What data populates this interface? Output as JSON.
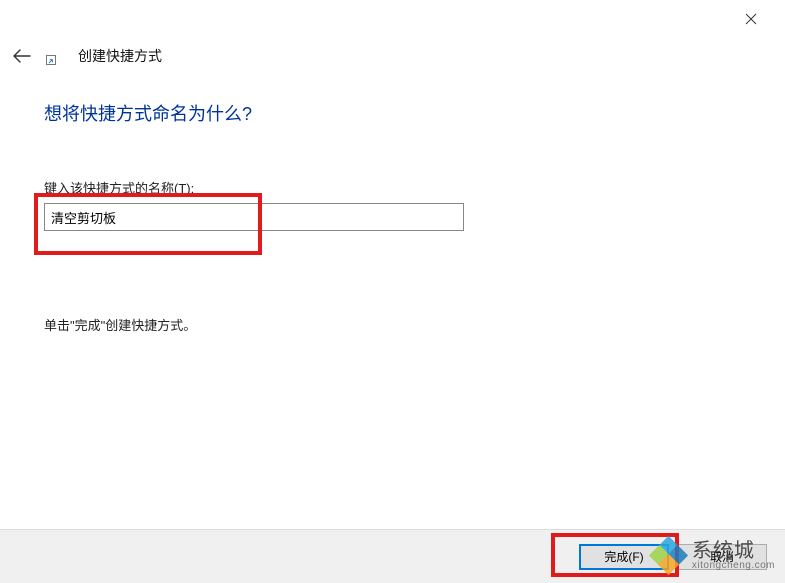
{
  "window": {
    "wizard_title": "创建快捷方式"
  },
  "content": {
    "heading": "想将快捷方式命名为什么?",
    "name_label": "键入该快捷方式的名称(T):",
    "name_value": "清空剪切板",
    "instruction": "单击\"完成\"创建快捷方式。"
  },
  "footer": {
    "finish_label": "完成(F)",
    "cancel_label": "取消"
  },
  "watermark": {
    "brand": "系统城",
    "domain": "xitongcheng.com"
  }
}
